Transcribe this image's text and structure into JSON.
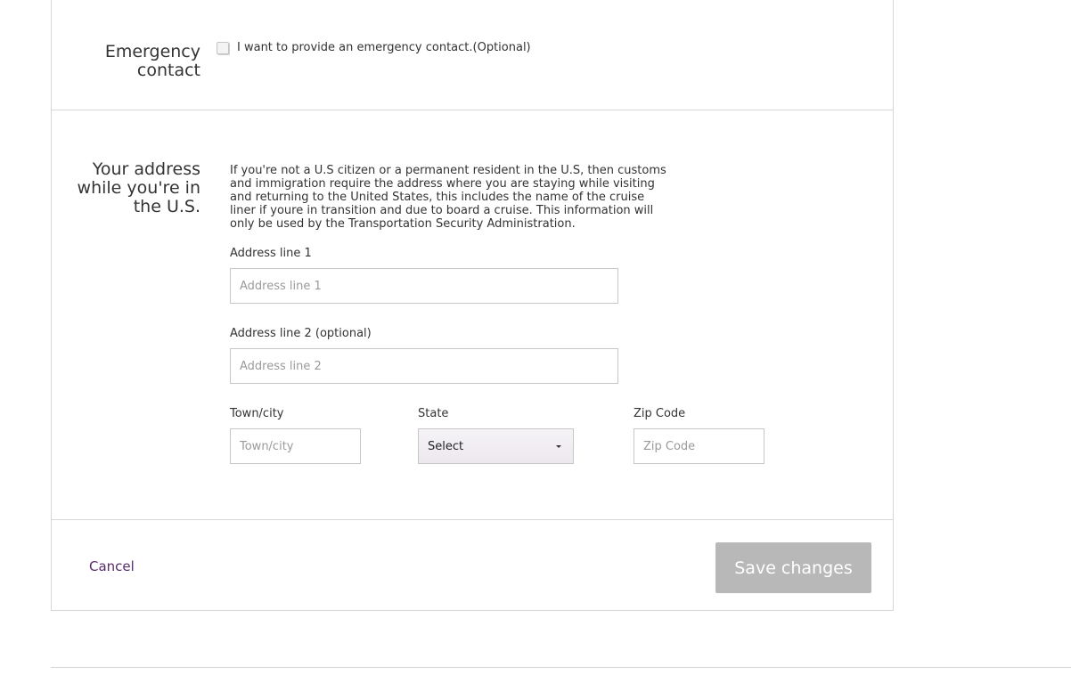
{
  "emergency": {
    "title": "Emergency contact",
    "checkbox_label": "I want to provide an emergency contact.(Optional)"
  },
  "address": {
    "title": "Your address while you're in the U.S.",
    "description": "If you're not a U.S citizen or a permanent resident in the U.S, then customs and immigration require the address where you are staying while visiting and returning to the United States, this includes the name of the cruise liner if youre in transition and due to board a cruise. This information will only be used by the Transportation Security Administration.",
    "line1_label": "Address line 1",
    "line1_placeholder": "Address line 1",
    "line2_label": "Address line 2 (optional)",
    "line2_placeholder": "Address line 2",
    "city_label": "Town/city",
    "city_placeholder": "Town/city",
    "state_label": "State",
    "state_value": "Select",
    "zip_label": "Zip Code",
    "zip_placeholder": "Zip Code"
  },
  "actions": {
    "cancel_label": "Cancel",
    "save_label": "Save changes"
  },
  "colors": {
    "link": "#5a2b6a",
    "disabled_button": "#b8b8b8",
    "border": "#d8d8d8"
  }
}
